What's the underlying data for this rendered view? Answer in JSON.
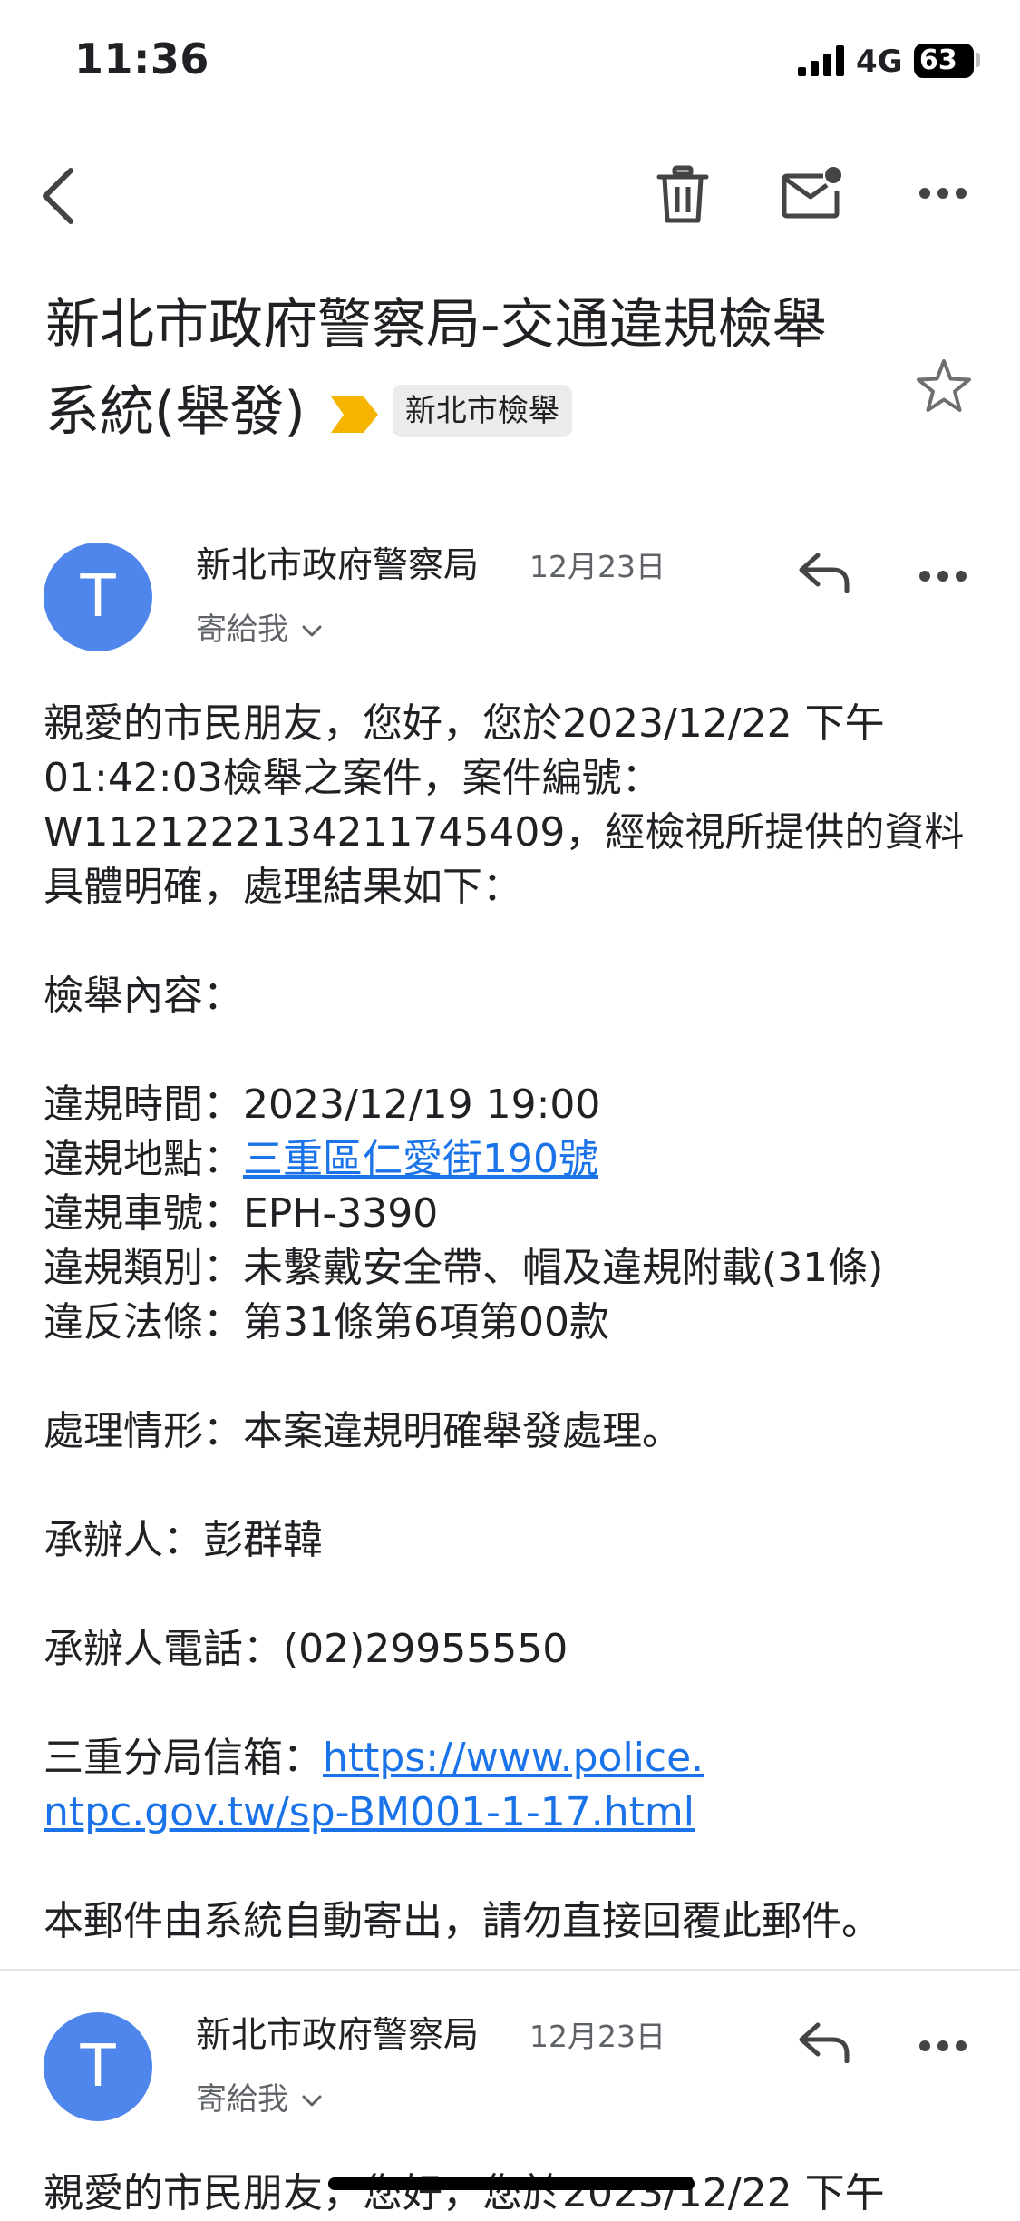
{
  "status_bar": {
    "time": "11:36",
    "network": "4G",
    "battery": "63"
  },
  "toolbar": {
    "back_icon": "chevron-left-icon",
    "delete_icon": "trash-icon",
    "mark_unread_icon": "mail-unread-icon",
    "more_icon": "more-horizontal-icon"
  },
  "subject": {
    "text": "新北市政府警察局-交通違規檢舉系統(舉發)",
    "label": "新北市檢舉",
    "importance_color": "#f4b400",
    "star_icon": "star-outline-icon"
  },
  "messages": [
    {
      "avatar_letter": "T",
      "avatar_color": "#4f86ec",
      "sender": "新北市政府警察局",
      "date": "12月23日",
      "recipient": "寄給我",
      "reply_icon": "reply-icon",
      "more_icon": "more-horizontal-icon",
      "body": {
        "intro": "親愛的市民朋友，您好，您於2023/12/22 下午01:42:03檢舉之案件，案件編號：W1121222134211745409，經檢視所提供的資料具體明確，處理結果如下：",
        "section_title": "檢舉內容：",
        "time_label": "違規時間：",
        "time_value": "2023/12/19 19:00",
        "location_label": "違規地點：",
        "location_value": "三重區仁愛街190號",
        "plate_label": "違規車號：",
        "plate_value": "EPH-3390",
        "category_label": "違規類別：",
        "category_value": "未繫戴安全帶、帽及違規附載(31條)",
        "law_label": "違反法條：",
        "law_value": "第31條第6項第00款",
        "status_label": "處理情形：",
        "status_value": "本案違規明確舉發處理。",
        "handler_label": "承辦人：",
        "handler_value": "彭群韓",
        "phone_label": "承辦人電話：",
        "phone_value": "(02)29955550",
        "mailbox_label": "三重分局信箱：",
        "mailbox_url_line1": "https://www.police.",
        "mailbox_url_line2": "ntpc.gov.tw/sp-BM001-1-17.html",
        "footer": "本郵件由系統自動寄出，請勿直接回覆此郵件。"
      }
    },
    {
      "avatar_letter": "T",
      "avatar_color": "#4f86ec",
      "sender": "新北市政府警察局",
      "date": "12月23日",
      "recipient": "寄給我",
      "reply_icon": "reply-icon",
      "more_icon": "more-horizontal-icon",
      "preview": "親愛的市民朋友，您好，您於2023/12/22 下午"
    }
  ]
}
